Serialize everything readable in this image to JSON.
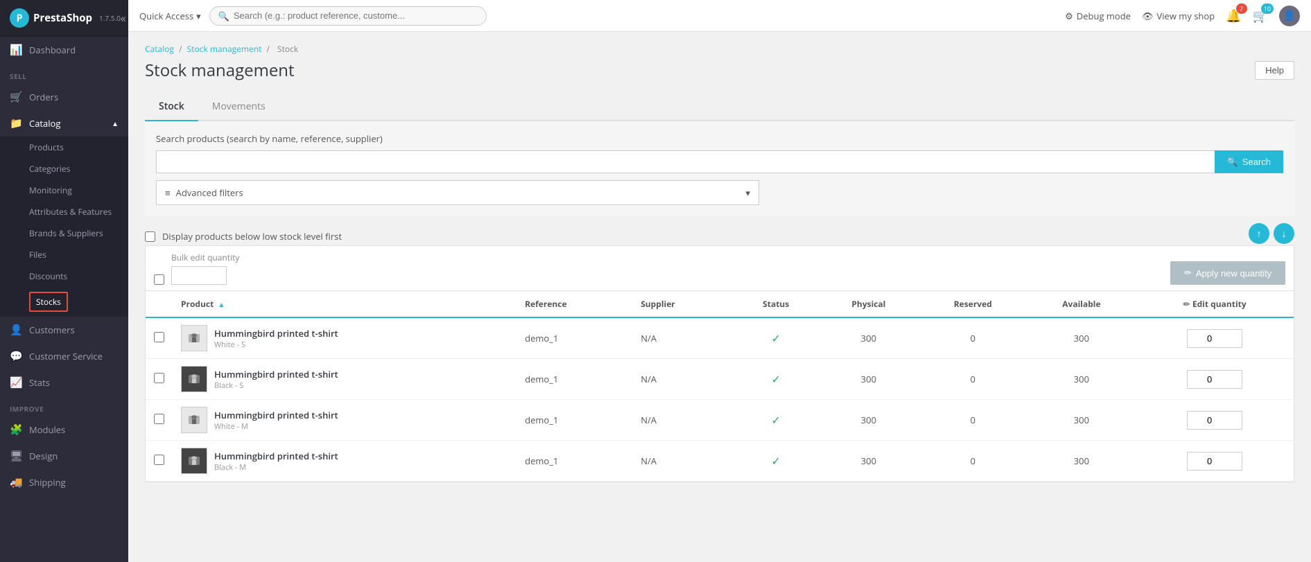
{
  "logo": {
    "name": "PrestaShop",
    "version": "1.7.5.0"
  },
  "topbar": {
    "quick_access_label": "Quick Access",
    "search_placeholder": "Search (e.g.: product reference, custome...",
    "debug_label": "Debug mode",
    "view_shop_label": "View my shop",
    "notifications_count": "7",
    "cart_count": "10"
  },
  "sidebar": {
    "sell_label": "SELL",
    "improve_label": "IMPROVE",
    "items": [
      {
        "id": "dashboard",
        "label": "Dashboard",
        "icon": "📊"
      },
      {
        "id": "orders",
        "label": "Orders",
        "icon": "🛒"
      },
      {
        "id": "catalog",
        "label": "Catalog",
        "icon": "📁",
        "expanded": true
      },
      {
        "id": "customers",
        "label": "Customers",
        "icon": "👤"
      },
      {
        "id": "customer-service",
        "label": "Customer Service",
        "icon": "💬"
      },
      {
        "id": "stats",
        "label": "Stats",
        "icon": "📈"
      },
      {
        "id": "modules",
        "label": "Modules",
        "icon": "🧩"
      },
      {
        "id": "design",
        "label": "Design",
        "icon": "🖥"
      },
      {
        "id": "shipping",
        "label": "Shipping",
        "icon": "🚚"
      }
    ],
    "catalog_subitems": [
      {
        "id": "products",
        "label": "Products"
      },
      {
        "id": "categories",
        "label": "Categories"
      },
      {
        "id": "monitoring",
        "label": "Monitoring"
      },
      {
        "id": "attributes-features",
        "label": "Attributes & Features"
      },
      {
        "id": "brands-suppliers",
        "label": "Brands & Suppliers"
      },
      {
        "id": "files",
        "label": "Files"
      },
      {
        "id": "discounts",
        "label": "Discounts"
      },
      {
        "id": "stocks",
        "label": "Stocks",
        "active": true
      }
    ]
  },
  "breadcrumb": {
    "parts": [
      "Catalog",
      "Stock management",
      "Stock"
    ]
  },
  "page": {
    "title": "Stock management",
    "help_label": "Help"
  },
  "tabs": [
    {
      "id": "stock",
      "label": "Stock",
      "active": true
    },
    {
      "id": "movements",
      "label": "Movements"
    }
  ],
  "search_section": {
    "label": "Search products (search by name, reference, supplier)",
    "placeholder": "",
    "button_label": "Search",
    "advanced_filters_label": "Advanced filters"
  },
  "stock_level": {
    "label": "Display products below low stock level first"
  },
  "bulk_edit": {
    "label": "Bulk edit quantity",
    "apply_label": "Apply new quantity"
  },
  "table": {
    "columns": [
      {
        "id": "product",
        "label": "Product",
        "sortable": true
      },
      {
        "id": "reference",
        "label": "Reference"
      },
      {
        "id": "supplier",
        "label": "Supplier"
      },
      {
        "id": "status",
        "label": "Status"
      },
      {
        "id": "physical",
        "label": "Physical"
      },
      {
        "id": "reserved",
        "label": "Reserved"
      },
      {
        "id": "available",
        "label": "Available"
      },
      {
        "id": "edit-quantity",
        "label": "Edit quantity"
      }
    ],
    "rows": [
      {
        "id": 1,
        "name": "Hummingbird printed t-shirt",
        "variant": "White - S",
        "reference": "demo_1",
        "supplier": "N/A",
        "status": "active",
        "physical": "300",
        "reserved": "0",
        "available": "300",
        "edit_qty": "0",
        "thumb_color": "#e0e0e0",
        "thumb_dark": false
      },
      {
        "id": 2,
        "name": "Hummingbird printed t-shirt",
        "variant": "Black - S",
        "reference": "demo_1",
        "supplier": "N/A",
        "status": "active",
        "physical": "300",
        "reserved": "0",
        "available": "300",
        "edit_qty": "0",
        "thumb_color": "#555",
        "thumb_dark": true
      },
      {
        "id": 3,
        "name": "Hummingbird printed t-shirt",
        "variant": "White - M",
        "reference": "demo_1",
        "supplier": "N/A",
        "status": "active",
        "physical": "300",
        "reserved": "0",
        "available": "300",
        "edit_qty": "0",
        "thumb_color": "#e0e0e0",
        "thumb_dark": false
      },
      {
        "id": 4,
        "name": "Hummingbird printed t-shirt",
        "variant": "Black - M",
        "reference": "demo_1",
        "supplier": "N/A",
        "status": "active",
        "physical": "300",
        "reserved": "0",
        "available": "300",
        "edit_qty": "0",
        "thumb_color": "#555",
        "thumb_dark": true
      }
    ]
  }
}
